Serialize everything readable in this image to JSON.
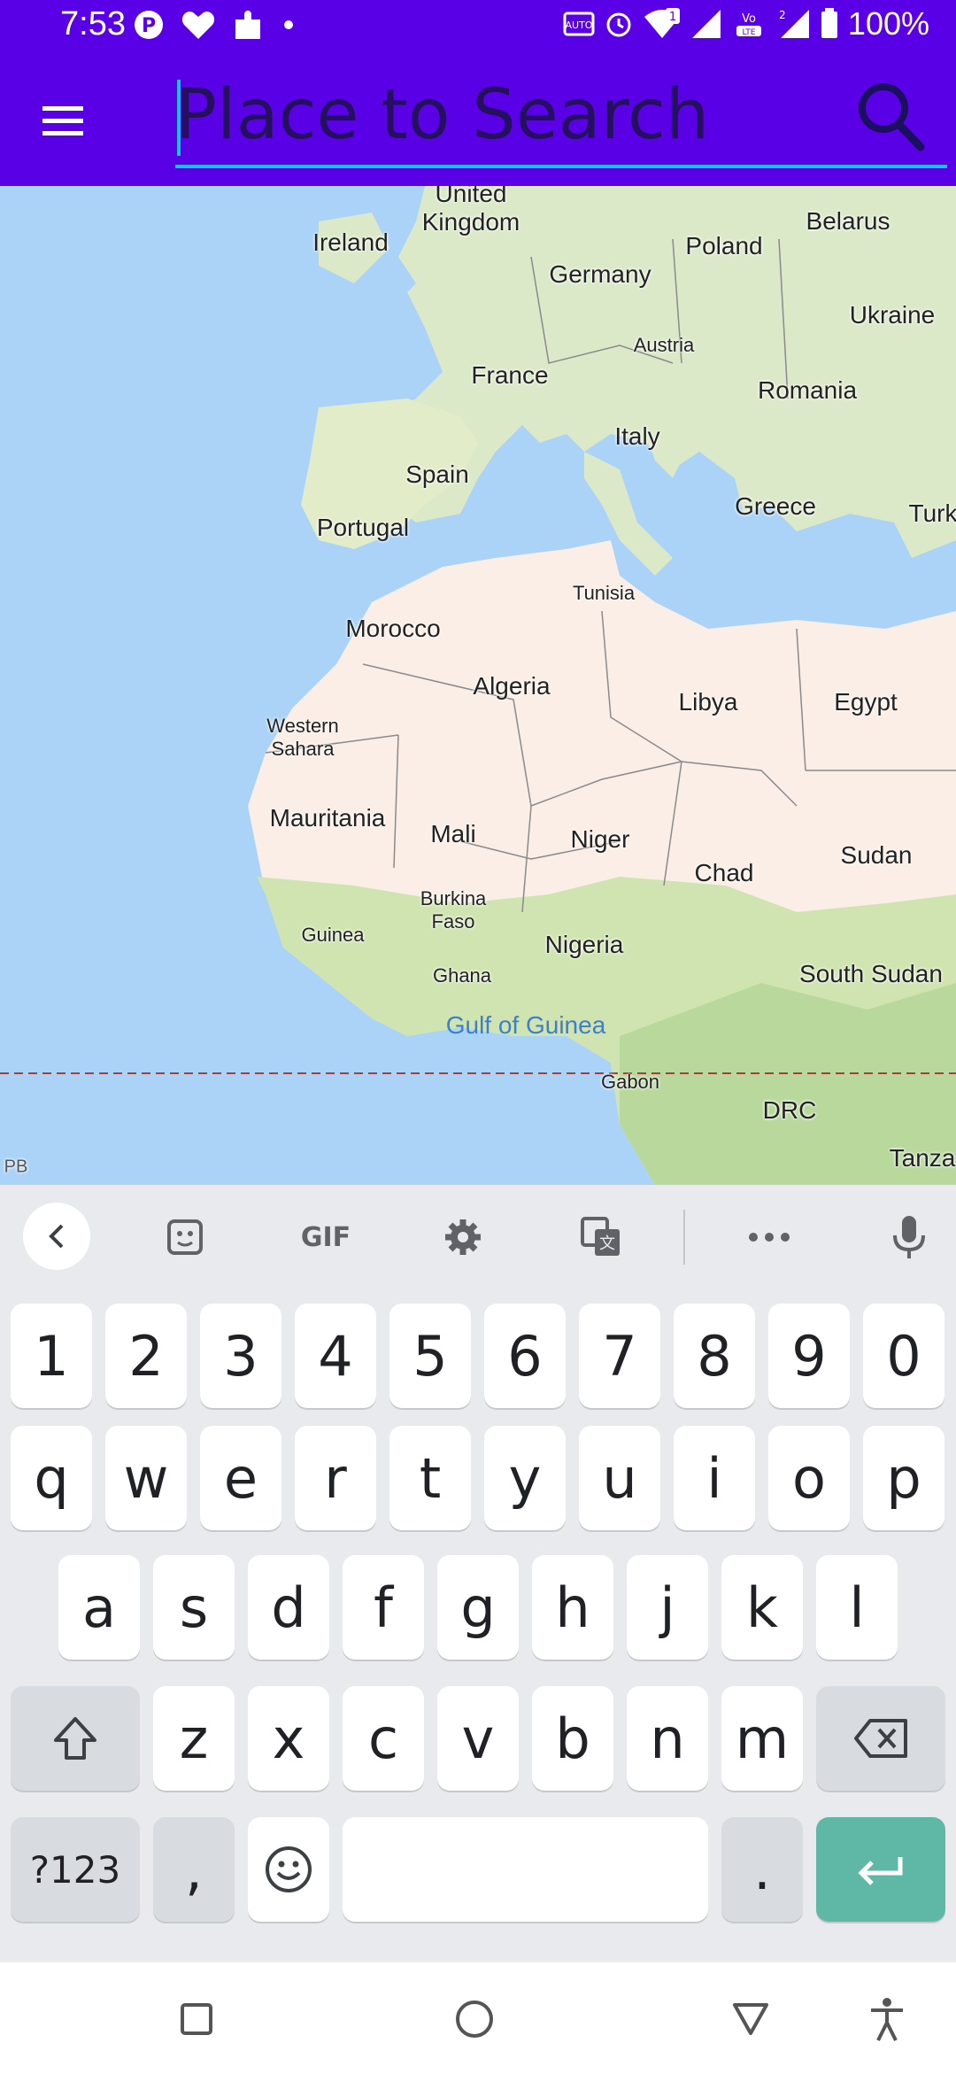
{
  "status_bar": {
    "time": "7:53",
    "battery": "100%",
    "left_icons": [
      "pinterest-icon",
      "heart-icon",
      "puzzle-icon",
      "dot-icon"
    ],
    "right_icons": [
      "auto-hd-icon",
      "alarm-icon",
      "wifi-icon",
      "signal-icon",
      "volte-icon",
      "signal-icon",
      "battery-icon"
    ],
    "wifi_badge": "1",
    "sim_badge": "2"
  },
  "app_bar": {
    "search_placeholder": "Place to Search",
    "search_value": ""
  },
  "map": {
    "labels": [
      {
        "id": "united-kingdom",
        "text": "United Kingdom"
      },
      {
        "id": "ireland",
        "text": "Ireland"
      },
      {
        "id": "germany",
        "text": "Germany"
      },
      {
        "id": "poland",
        "text": "Poland"
      },
      {
        "id": "belarus",
        "text": "Belarus"
      },
      {
        "id": "ukraine",
        "text": "Ukraine"
      },
      {
        "id": "austria",
        "text": "Austria"
      },
      {
        "id": "france",
        "text": "France"
      },
      {
        "id": "romania",
        "text": "Romania"
      },
      {
        "id": "italy",
        "text": "Italy"
      },
      {
        "id": "spain",
        "text": "Spain"
      },
      {
        "id": "portugal",
        "text": "Portugal"
      },
      {
        "id": "greece",
        "text": "Greece"
      },
      {
        "id": "turkey",
        "text": "Turk"
      },
      {
        "id": "tunisia",
        "text": "Tunisia"
      },
      {
        "id": "morocco",
        "text": "Morocco"
      },
      {
        "id": "algeria",
        "text": "Algeria"
      },
      {
        "id": "libya",
        "text": "Libya"
      },
      {
        "id": "egypt",
        "text": "Egypt"
      },
      {
        "id": "western-sahara",
        "text": "Western Sahara"
      },
      {
        "id": "mauritania",
        "text": "Mauritania"
      },
      {
        "id": "mali",
        "text": "Mali"
      },
      {
        "id": "niger",
        "text": "Niger"
      },
      {
        "id": "chad",
        "text": "Chad"
      },
      {
        "id": "sudan",
        "text": "Sudan"
      },
      {
        "id": "burkina-faso",
        "text": "Burkina Faso"
      },
      {
        "id": "guinea",
        "text": "Guinea"
      },
      {
        "id": "nigeria",
        "text": "Nigeria"
      },
      {
        "id": "ghana",
        "text": "Ghana"
      },
      {
        "id": "south-sudan",
        "text": "South Sudan"
      },
      {
        "id": "gulf-of-guinea",
        "text": "Gulf of Guinea"
      },
      {
        "id": "gabon",
        "text": "Gabon"
      },
      {
        "id": "drc",
        "text": "DRC"
      },
      {
        "id": "tanzania",
        "text": "Tanza"
      },
      {
        "id": "pb",
        "text": "PB"
      }
    ]
  },
  "keyboard": {
    "toolbar": {
      "back": "chevron-left-icon",
      "sticker": "sticker-icon",
      "gif": "GIF",
      "settings": "gear-icon",
      "translate": "translate-icon",
      "more": "more-icon",
      "mic": "mic-icon"
    },
    "row_numbers": [
      "1",
      "2",
      "3",
      "4",
      "5",
      "6",
      "7",
      "8",
      "9",
      "0"
    ],
    "row_1": [
      "q",
      "w",
      "e",
      "r",
      "t",
      "y",
      "u",
      "i",
      "o",
      "p"
    ],
    "row_2": [
      "a",
      "s",
      "d",
      "f",
      "g",
      "h",
      "j",
      "k",
      "l"
    ],
    "row_3": [
      "z",
      "x",
      "c",
      "v",
      "b",
      "n",
      "m"
    ],
    "symbols_key": "?123",
    "comma_key": ",",
    "period_key": ".",
    "enter_color": "#5fb8a6"
  },
  "nav_bar": {
    "buttons": [
      "recents-icon",
      "home-icon",
      "back-icon",
      "accessibility-icon"
    ]
  },
  "colors": {
    "app_bar": "#5a00e6",
    "search_underline": "#16c3e6",
    "map_water": "#aad3f7"
  }
}
